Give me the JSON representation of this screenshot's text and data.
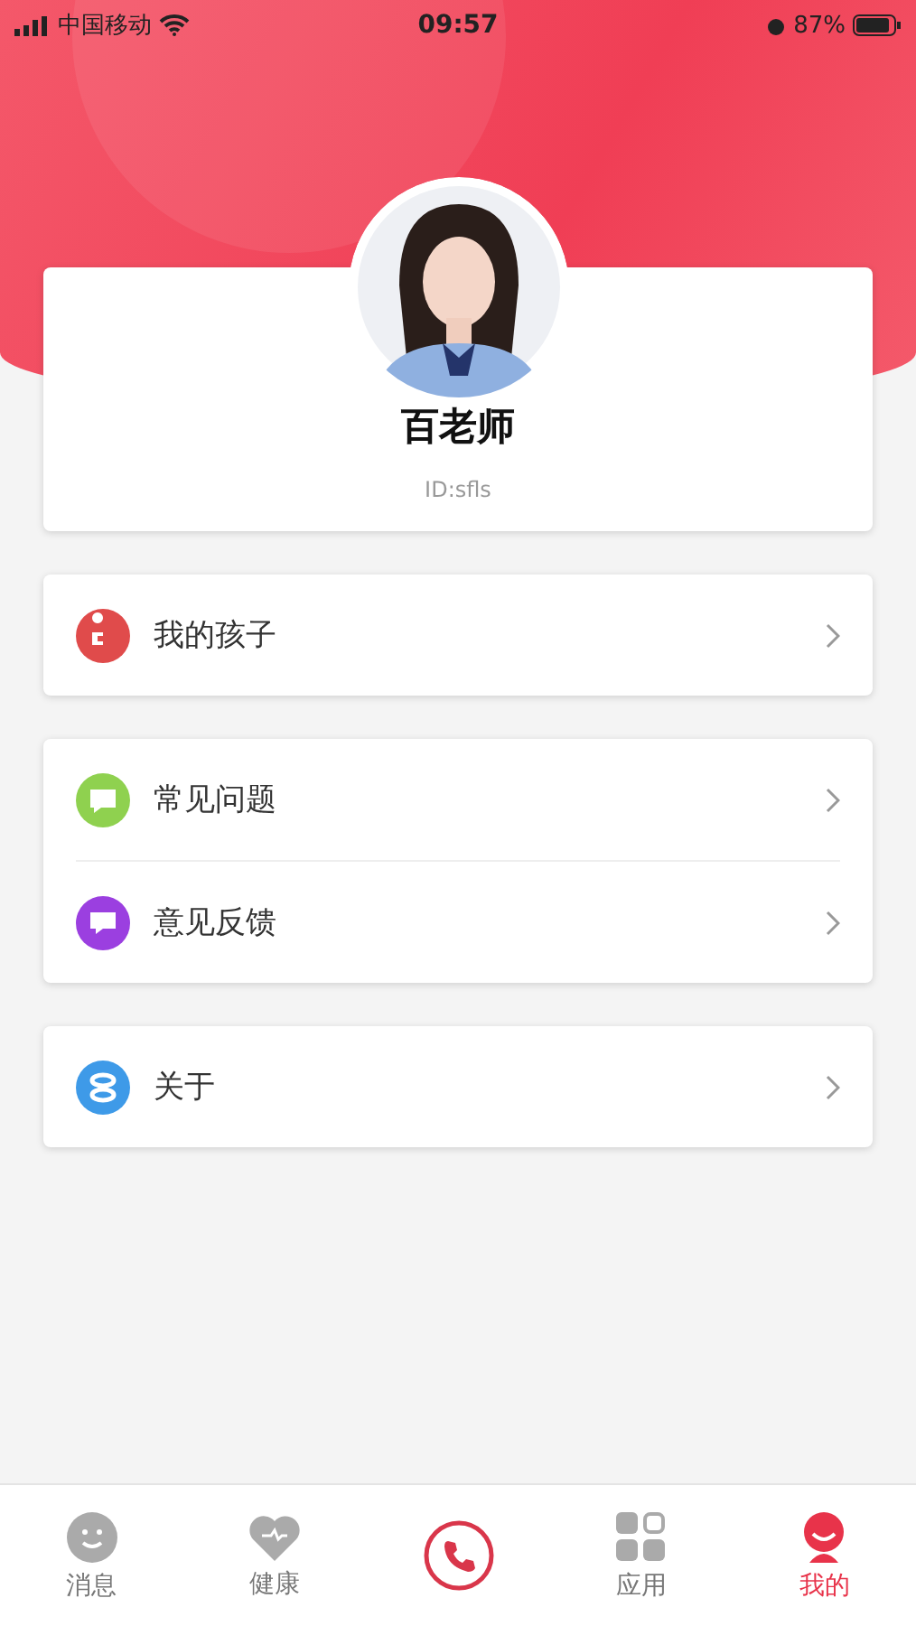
{
  "status_bar": {
    "carrier": "中国移动",
    "time": "09:57",
    "battery": "87%"
  },
  "profile": {
    "name": "百老师",
    "id": "ID:sfls"
  },
  "menu_groups": [
    {
      "items": [
        {
          "label": "我的孩子",
          "kind": "child",
          "color": "#e04b4b"
        }
      ]
    },
    {
      "items": [
        {
          "label": "常见问题",
          "kind": "question",
          "color": "#8fd14f"
        },
        {
          "label": "意见反馈",
          "kind": "feedback",
          "color": "#9b3fe0"
        }
      ]
    },
    {
      "items": [
        {
          "label": "关于",
          "kind": "about",
          "color": "#3e9ae8"
        }
      ]
    }
  ],
  "tab_bar": [
    {
      "label": "消息",
      "kind": "smile",
      "selected": false
    },
    {
      "label": "健康",
      "kind": "heart",
      "selected": false
    },
    {
      "kind": "phone",
      "selected": false
    },
    {
      "label": "应用",
      "kind": "apps",
      "selected": false
    },
    {
      "label": "我的",
      "kind": "person",
      "selected": true
    }
  ]
}
